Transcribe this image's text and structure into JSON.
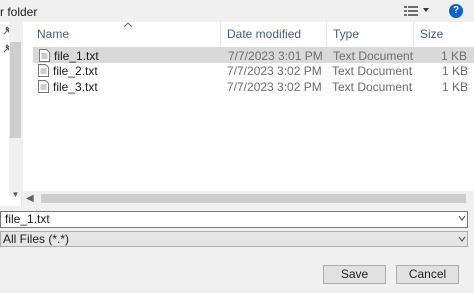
{
  "toolbar": {
    "new_folder_label": "r folder",
    "help_label": "?"
  },
  "columns": {
    "name": "Name",
    "date_modified": "Date modified",
    "type": "Type",
    "size": "Size"
  },
  "files": [
    {
      "name": "file_1.txt",
      "date": "7/7/2023 3:01 PM",
      "type": "Text Document",
      "size": "1 KB",
      "selected": true
    },
    {
      "name": "file_2.txt",
      "date": "7/7/2023 3:02 PM",
      "type": "Text Document",
      "size": "1 KB",
      "selected": false
    },
    {
      "name": "file_3.txt",
      "date": "7/7/2023 3:02 PM",
      "type": "Text Document",
      "size": "1 KB",
      "selected": false
    }
  ],
  "file_name_field": {
    "value": "file_1.txt"
  },
  "file_type_select": {
    "value": "All Files (*.*)"
  },
  "buttons": {
    "save": "Save",
    "cancel": "Cancel"
  },
  "icons": {
    "pin": "pin-icon",
    "view": "view-options-icon",
    "help": "help-icon",
    "file": "text-file-icon"
  },
  "colors": {
    "selected_row": "#d9d9d9",
    "header_text": "#4c607a",
    "help_blue": "#0b63ce"
  }
}
